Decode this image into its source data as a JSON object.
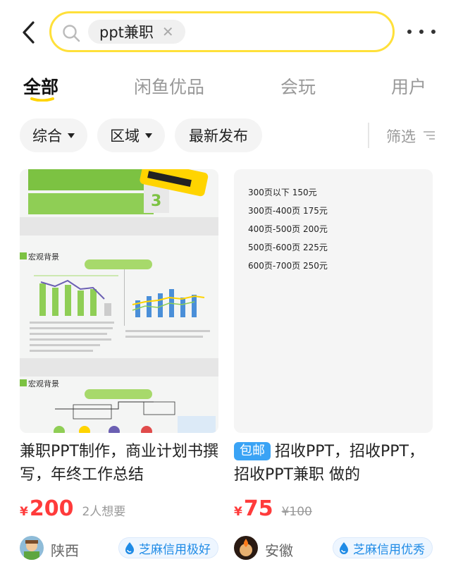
{
  "header": {
    "query": "ppt兼职"
  },
  "tabs": [
    {
      "label": "全部",
      "active": true
    },
    {
      "label": "闲鱼优品"
    },
    {
      "label": "会玩"
    },
    {
      "label": "用户"
    }
  ],
  "filters": {
    "sort": "综合",
    "area": "区域",
    "latest": "最新发布",
    "filter": "筛选"
  },
  "colors": {
    "accent_yellow": "#ffe03a",
    "price_red": "#ff3b3b",
    "credit_blue": "#1f8be6",
    "badge_blue": "#3aa3f5"
  },
  "listings": [
    {
      "title": "兼职PPT制作，商业计划书撰写，年终工作总结",
      "currency": "¥",
      "price": "200",
      "wants": "2人想要",
      "region": "陕西",
      "credit": "芝麻信用极好",
      "image": {
        "section_title_1": "宏观背景",
        "section_title_2": "宏观背景"
      }
    },
    {
      "badge": "包邮",
      "title": "招收PPT，招收PPT，招收PPT兼职 做的",
      "currency": "¥",
      "price": "75",
      "original_price": "¥100",
      "region": "安徽",
      "credit": "芝麻信用优秀",
      "image": {
        "price_list": [
          "300页以下   150元",
          "300页-400页  175元",
          "400页-500页  200元",
          "500页-600页  225元",
          "600页-700页  250元"
        ]
      }
    }
  ]
}
